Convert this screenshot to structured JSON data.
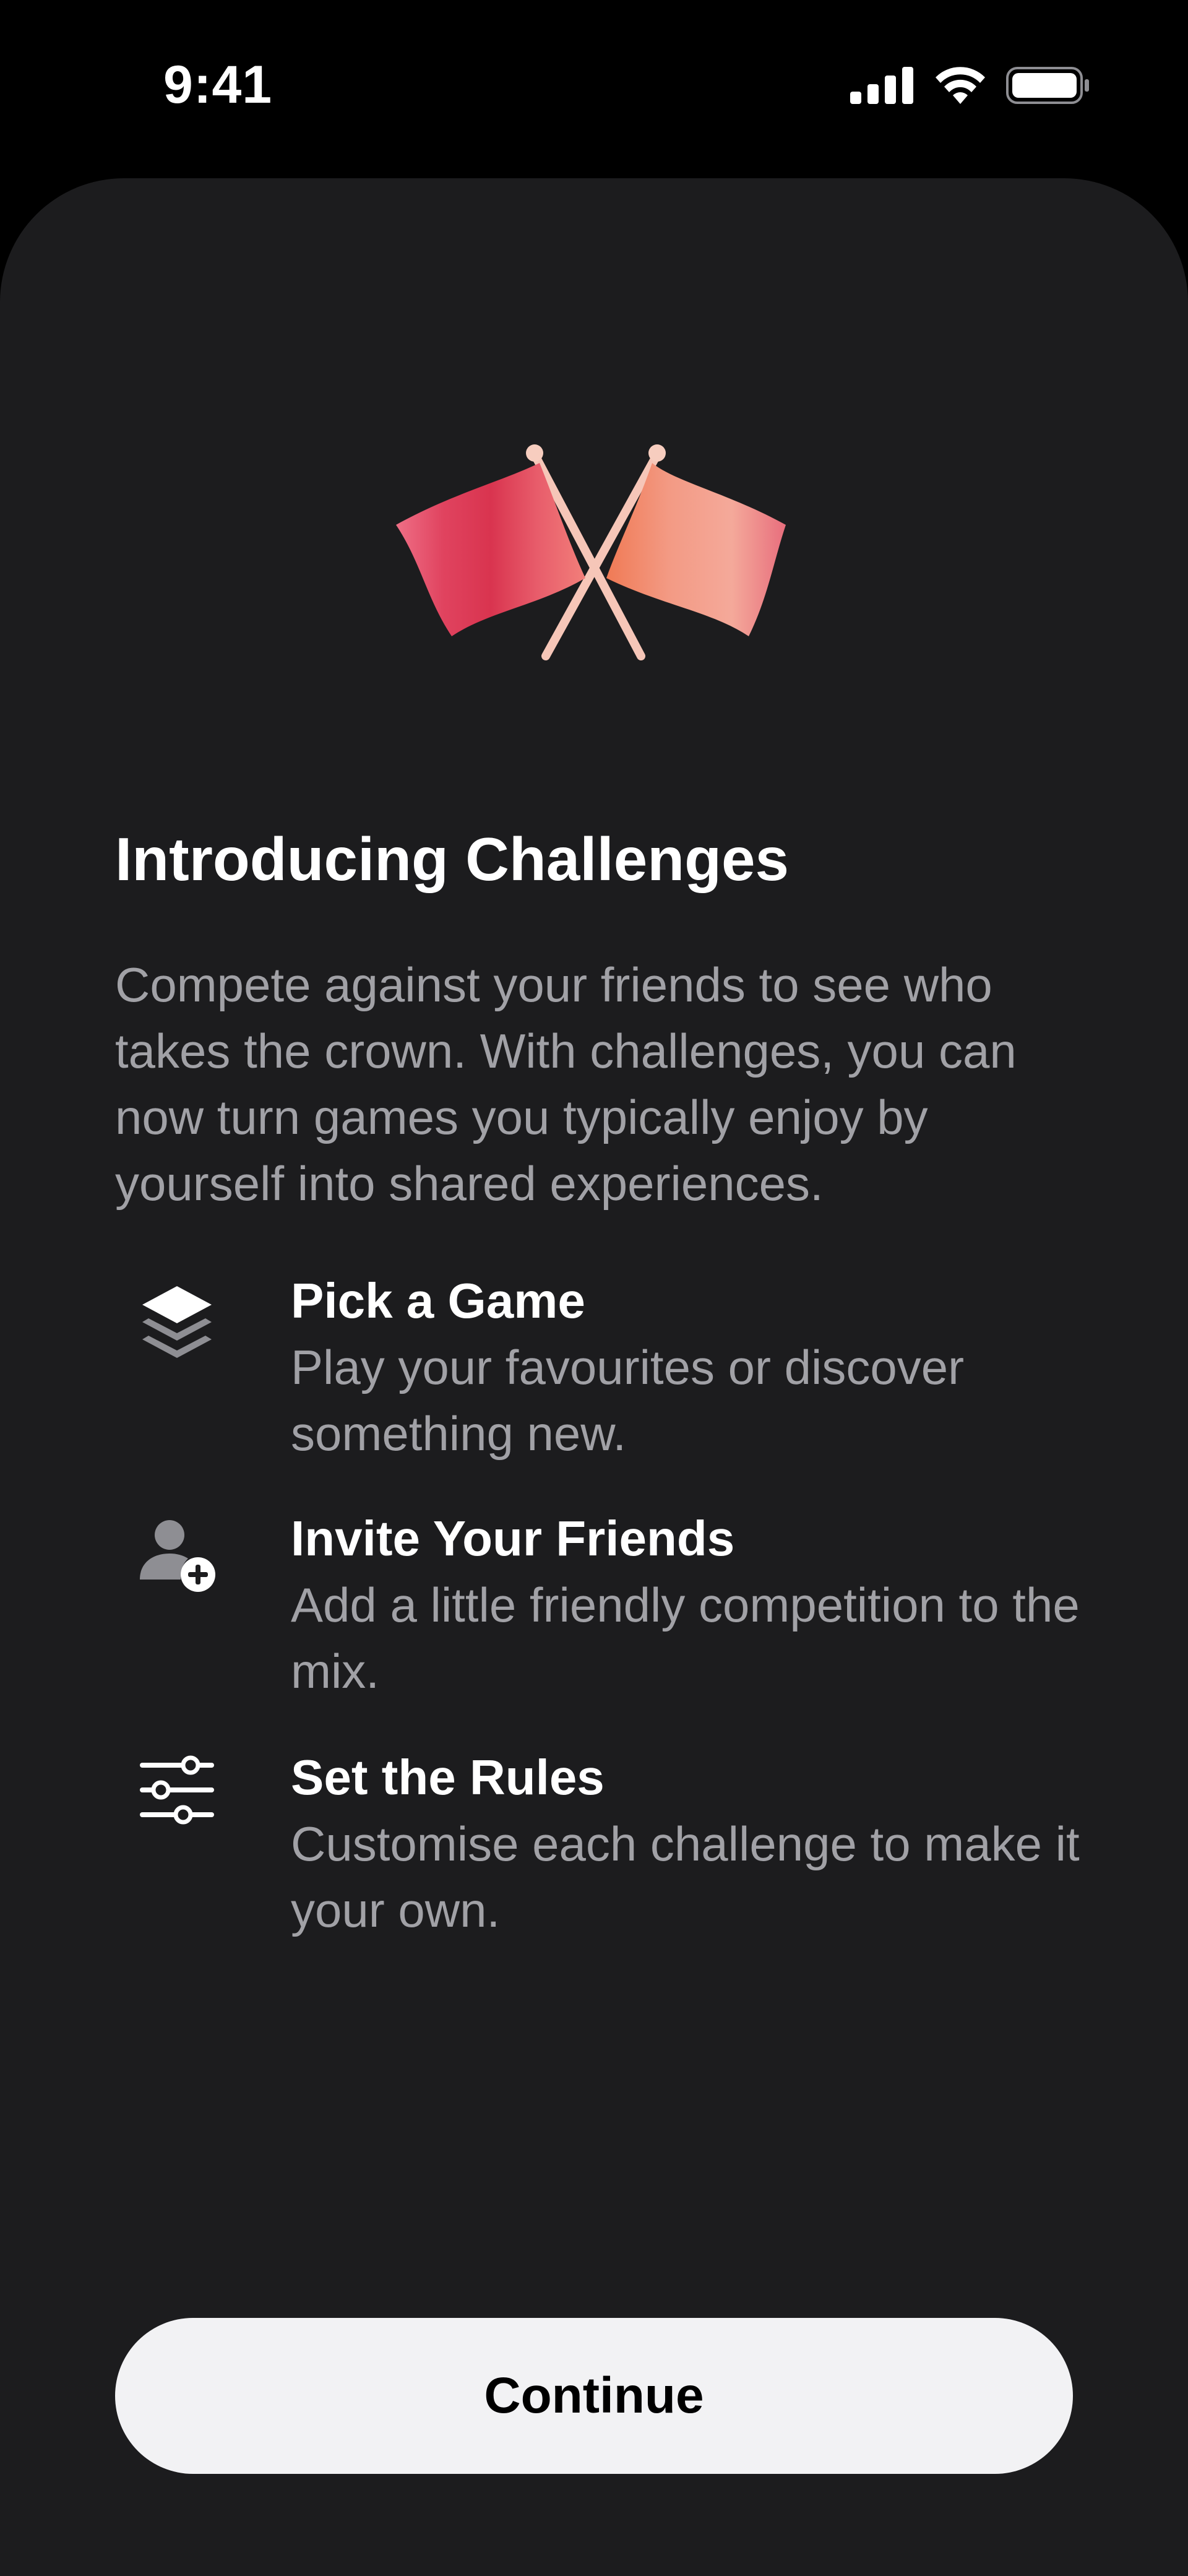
{
  "status_bar": {
    "time": "9:41",
    "icons": [
      "signal-icon",
      "wifi-icon",
      "battery-icon"
    ]
  },
  "sheet": {
    "hero_icon": "crossed-flags-icon",
    "title": "Introducing Challenges",
    "description": "Compete against your friends to see who takes the crown. With challenges, you can now turn games you typically enjoy by yourself into shared experiences.",
    "features": [
      {
        "icon": "layers-icon",
        "title": "Pick a Game",
        "body": "Play your favourites or discover something new."
      },
      {
        "icon": "add-person-icon",
        "title": "Invite Your Friends",
        "body": "Add a little friendly competition to the mix."
      },
      {
        "icon": "sliders-icon",
        "title": "Set the Rules",
        "body": "Customise each challenge to make it your own."
      }
    ],
    "continue_label": "Continue"
  },
  "colors": {
    "background": "#000000",
    "sheet": "#1c1c1e",
    "primary_text": "#ffffff",
    "secondary_text": "#a1a1a6",
    "button_bg": "#f2f2f4",
    "button_text": "#000000",
    "flag_left": "#e0435f",
    "flag_right": "#f08a6a"
  }
}
